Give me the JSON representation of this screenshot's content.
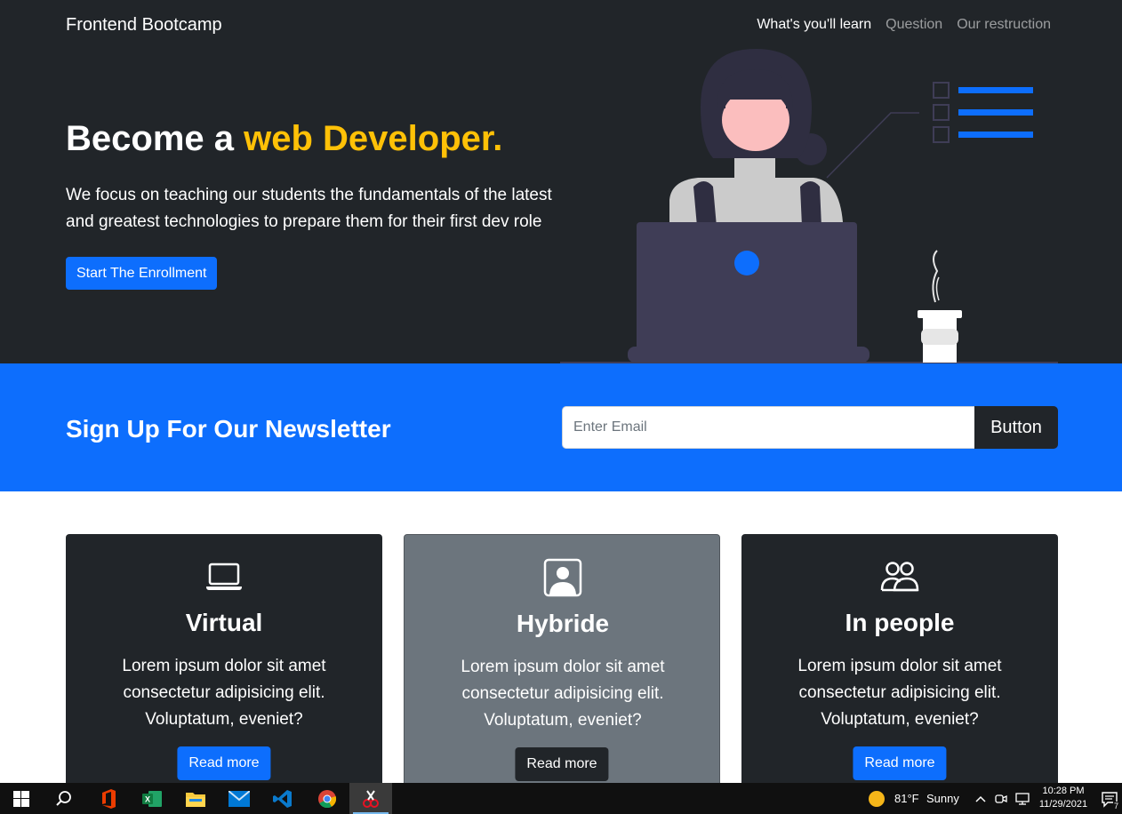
{
  "nav": {
    "brand": "Frontend Bootcamp",
    "links": [
      "What's you'll learn",
      "Question",
      "Our restruction"
    ]
  },
  "hero": {
    "title_prefix": "Become a ",
    "title_highlight": "web Developer.",
    "text": "We focus on teaching our students the fundamentals of the latest and greatest technologies to prepare them for their first dev role",
    "button": "Start The Enrollment"
  },
  "newsletter": {
    "title": "Sign Up For Our Newsletter",
    "placeholder": "Enter Email",
    "value": "",
    "button": "Button"
  },
  "cards": [
    {
      "icon": "laptop-icon",
      "title": "Virtual",
      "text": "Lorem ipsum dolor sit amet consectetur adipisicing elit. Voluptatum, eveniet?",
      "button": "Read more"
    },
    {
      "icon": "person-square-icon",
      "title": "Hybride",
      "text": "Lorem ipsum dolor sit amet consectetur adipisicing elit. Voluptatum, eveniet?",
      "button": "Read more"
    },
    {
      "icon": "people-icon",
      "title": "In people",
      "text": "Lorem ipsum dolor sit amet consectetur adipisicing elit. Voluptatum, eveniet?",
      "button": "Read more"
    }
  ],
  "taskbar": {
    "apps": [
      "windows-start-icon",
      "search-icon",
      "office-icon",
      "excel-icon",
      "file-explorer-icon",
      "mail-icon",
      "vscode-icon",
      "chrome-icon",
      "snipping-tool-icon"
    ],
    "weather_temp": "81°F",
    "weather_text": "Sunny",
    "time": "10:28 PM",
    "date": "11/29/2021",
    "notification_count": "7"
  },
  "colors": {
    "dark": "#212529",
    "primary": "#0d6efd",
    "warning": "#ffc107",
    "secondary": "#6c757d"
  }
}
